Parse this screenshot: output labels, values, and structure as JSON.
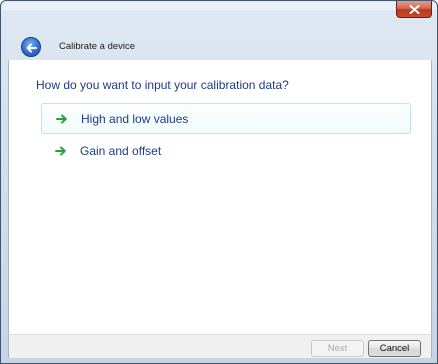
{
  "window": {
    "title": "Calibrate a device",
    "close_icon": "close-icon",
    "back_icon": "back-arrow-icon"
  },
  "main": {
    "prompt": "How do you want to input your calibration data?",
    "options": [
      {
        "label": "High and low values",
        "icon": "green-arrow-icon",
        "highlighted": true
      },
      {
        "label": "Gain and offset",
        "icon": "green-arrow-icon",
        "highlighted": false
      }
    ]
  },
  "footer": {
    "next_label": "Next",
    "next_enabled": false,
    "cancel_label": "Cancel"
  },
  "colors": {
    "link_text": "#1e3b8a",
    "arrow_green": "#27a33a",
    "close_red": "#c64a2c"
  }
}
